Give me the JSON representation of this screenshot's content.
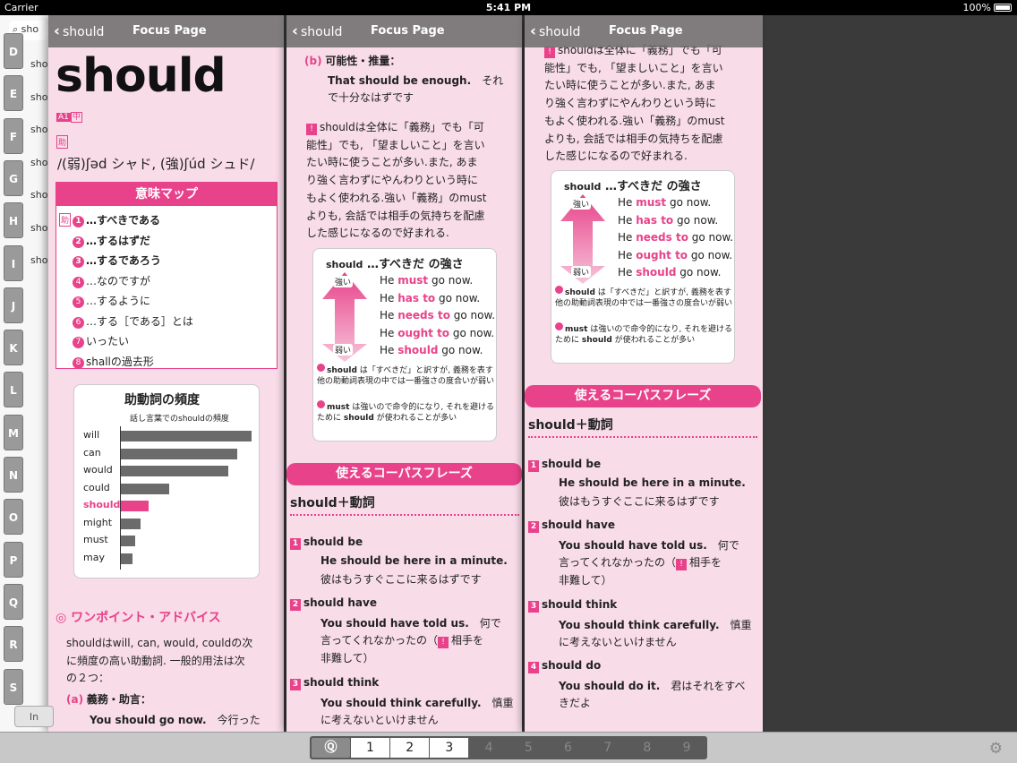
{
  "status": {
    "carrier": "Carrier",
    "time": "5:41 PM",
    "battery": "100%"
  },
  "index_sidebar": {
    "search_value": "sho",
    "letters": [
      "D",
      "E",
      "F",
      "G",
      "H",
      "I",
      "J",
      "K",
      "L",
      "M",
      "N",
      "O",
      "P",
      "Q",
      "R",
      "S"
    ],
    "rows": [
      "sho",
      "sho",
      "sho",
      "sho",
      "sho",
      "sho",
      "sho"
    ],
    "bottom_button": "In"
  },
  "panel1": {
    "back_label": "should",
    "title": "Focus Page",
    "headword": "should",
    "level_badge": "A1",
    "level_tag": "中",
    "pos_tag": "助",
    "pronunciation": "/(弱)ʃəd シャド, (強)ʃúd シュド/",
    "meaning_map_title": "意味マップ",
    "meanings": [
      {
        "num": "1",
        "text": "…すべきである",
        "bold": true
      },
      {
        "num": "2",
        "text": "…するはずだ",
        "bold": true
      },
      {
        "num": "3",
        "text": "…するであろう",
        "bold": true
      },
      {
        "num": "4",
        "text": "…なのですが",
        "bold": false
      },
      {
        "num": "5",
        "text": "…するように",
        "bold": false
      },
      {
        "num": "6",
        "text": "…する［である］とは",
        "bold": false
      },
      {
        "num": "7",
        "text": "いったい",
        "bold": false
      },
      {
        "num": "8",
        "text": "shallの過去形",
        "bold": false
      }
    ],
    "freq_title": "助動詞の頻度",
    "freq_subtitle": "話し言葉でのshouldの頻度",
    "one_point_title": "◎ ワンポイント・アドバイス",
    "one_point_text": [
      "shouldはwill, can, would, couldの次",
      "に頻度の高い助動詞. 一般的用法は次",
      "の２つ："
    ],
    "usage_a_label": "(a)",
    "usage_a_title": "義務・助言：",
    "usage_a_example": "You should go now.",
    "usage_a_trans": "今行った"
  },
  "chart_data": {
    "type": "bar",
    "title": "助動詞の頻度",
    "subtitle": "話し言葉でのshouldの頻度",
    "orientation": "horizontal",
    "categories": [
      "will",
      "can",
      "would",
      "could",
      "should",
      "might",
      "must",
      "may"
    ],
    "values": [
      100,
      89,
      82,
      37,
      21,
      15,
      11,
      9
    ],
    "highlight": "should",
    "colors": {
      "default": "#6b6b6b",
      "highlight": "#e8428a"
    }
  },
  "panel2": {
    "back_label": "should",
    "title": "Focus Page",
    "b_label": "(b)",
    "b_title": "可能性・推量：",
    "b_example": "That should be enough.",
    "b_trans": [
      "それ",
      "で十分なはずです"
    ],
    "note_lines": [
      "shouldは全体に「義務」でも「可",
      "能性」でも, 「望ましいこと」を言い",
      "たい時に使うことが多い.また, あま",
      "り強く言わずにやんわりという時に",
      "もよく使われる.強い「義務」のmust",
      "よりも, 会話では相手の気持ちを配慮",
      "した感じになるので好まれる."
    ],
    "phrases_title": "使えるコーパスフレーズ",
    "phrases_sub": "should＋動詞",
    "phrases": [
      {
        "num": "1",
        "label": "should be",
        "en": "He should be here in a minute.",
        "ja": [
          "彼はもうすぐここに来るはずです"
        ]
      },
      {
        "num": "2",
        "label": "should have",
        "en": "You should have told us.",
        "ja": [
          "何で",
          "言ってくれなかったの（",
          "相手を",
          "非難して）"
        ]
      },
      {
        "num": "3",
        "label": "should think",
        "en": "You should think carefully.",
        "ja": [
          "慎重",
          "に考えないといけません"
        ]
      },
      {
        "num": "4",
        "label": "should do",
        "en": "",
        "ja": []
      }
    ]
  },
  "strength_box": {
    "title_word": "should",
    "title_rest": "…すべきだ の強さ",
    "strong": "強い",
    "weak": "弱い",
    "rows": [
      {
        "pre": "He",
        "mod": "must",
        "post": "go now."
      },
      {
        "pre": "He",
        "mod": "has to",
        "post": "go now."
      },
      {
        "pre": "He",
        "mod": "needs to",
        "post": "go now."
      },
      {
        "pre": "He",
        "mod": "ought to",
        "post": "go now."
      },
      {
        "pre": "He",
        "mod": "should",
        "post": "go now."
      }
    ],
    "note1_word": "should",
    "note1": [
      "は「すべきだ」と訳すが, 義",
      "務を表す他の助動詞表現の中では一番強",
      "さの度合いが弱い"
    ],
    "note2_word": "must",
    "note2": [
      "は強いので命令的になり, それ",
      "を避けるために",
      "が使われること",
      "が多い"
    ]
  },
  "panel3": {
    "back_label": "should",
    "title": "Focus Page",
    "note_lines": [
      "shouldは全体に「義務」でも「可",
      "能性」でも, 「望ましいこと」を言い",
      "たい時に使うことが多い.また, あま",
      "り強く言わずにやんわりという時に",
      "もよく使われる.強い「義務」のmust",
      "よりも, 会話では相手の気持ちを配慮",
      "した感じになるので好まれる."
    ],
    "phrase4_example": "You should do it.",
    "phrase4_trans": [
      "君はそれをすべ",
      "きだよ"
    ]
  },
  "pager": {
    "pages": [
      "1",
      "2",
      "3",
      "4",
      "5",
      "6",
      "7",
      "8",
      "9"
    ],
    "active_count": 3
  }
}
